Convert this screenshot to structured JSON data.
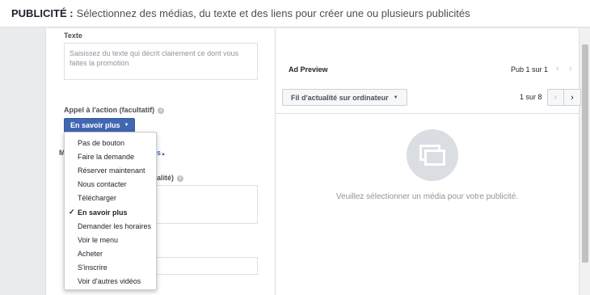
{
  "header": {
    "title": "PUBLICITÉ :",
    "subtitle": "Sélectionnez des médias, du texte et des liens pour créer une ou plusieurs publicités"
  },
  "form": {
    "texte_label": "Texte",
    "texte_placeholder": "Saisissez du texte qui décrit clairement ce dont vous faites la promotion",
    "cta_label": "Appel à l'action (facultatif)",
    "cta_value": "En savoir plus",
    "partial_left_letter": "M",
    "partial_right_text": "s",
    "partial_optional_text": "alité)"
  },
  "cta_dropdown": {
    "options": [
      {
        "label": "Pas de bouton",
        "selected": false
      },
      {
        "label": "Faire la demande",
        "selected": false
      },
      {
        "label": "Réserver maintenant",
        "selected": false
      },
      {
        "label": "Nous contacter",
        "selected": false
      },
      {
        "label": "Télécharger",
        "selected": false
      },
      {
        "label": "En savoir plus",
        "selected": true
      },
      {
        "label": "Demander les horaires",
        "selected": false
      },
      {
        "label": "Voir le menu",
        "selected": false
      },
      {
        "label": "Acheter",
        "selected": false
      },
      {
        "label": "S'inscrire",
        "selected": false
      },
      {
        "label": "Voir d'autres vidéos",
        "selected": false
      }
    ],
    "check_glyph": "✓"
  },
  "preview": {
    "title": "Ad Preview",
    "pub_count": "Pub 1 sur 1",
    "placement": "Fil d'actualité sur ordinateur",
    "page_count": "1 sur 8",
    "empty_message": "Veuillez sélectionner un média pour votre publicité."
  },
  "colors": {
    "brand_blue": "#4267b2",
    "panel_bg": "#ffffff",
    "page_bg": "#e9ebee"
  }
}
